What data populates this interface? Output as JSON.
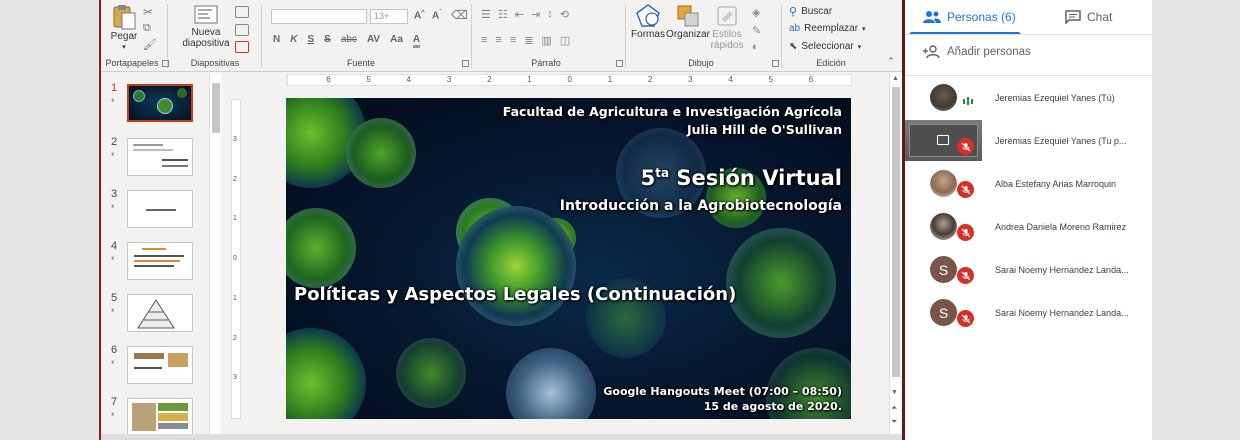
{
  "ribbon": {
    "groups": [
      {
        "label": "Portapapeles"
      },
      {
        "label": "Diapositivas"
      },
      {
        "label": "Fuente"
      },
      {
        "label": "Párrafo"
      },
      {
        "label": "Dibujo"
      },
      {
        "label": "Edición"
      }
    ],
    "paste_label": "Pegar",
    "new_slide_label_1": "Nueva",
    "new_slide_label_2": "diapositiva",
    "font_size": "13+",
    "formatting": [
      "N",
      "K",
      "S",
      "S",
      "abc",
      "AV",
      "Aa",
      "A"
    ],
    "drawing": {
      "shapes_label": "Formas",
      "arrange_label": "Organizar",
      "quick_styles_label_1": "Estilos",
      "quick_styles_label_2": "rápidos"
    },
    "editing": {
      "find_label": "Buscar",
      "replace_label": "Reemplazar",
      "select_label": "Seleccionar"
    }
  },
  "thumbnails": [
    {
      "num": "1",
      "star": "*"
    },
    {
      "num": "2",
      "star": "*"
    },
    {
      "num": "3",
      "star": "*"
    },
    {
      "num": "4",
      "star": "*"
    },
    {
      "num": "5",
      "star": "*"
    },
    {
      "num": "6",
      "star": "*"
    },
    {
      "num": "7",
      "star": "*"
    }
  ],
  "ruler_h": [
    "6",
    "5",
    "4",
    "3",
    "2",
    "1",
    "0",
    "1",
    "2",
    "3",
    "4",
    "5",
    "6"
  ],
  "ruler_v": [
    "3",
    "2",
    "1",
    "0",
    "1",
    "2",
    "3"
  ],
  "slide": {
    "faculty": "Facultad de Agricultura e Investigación Agrícola",
    "author": "Julia Hill de O'Sullivan",
    "session_num": "5",
    "session_sup": "ta",
    "session_rest": " Sesión Virtual",
    "subtitle": "Introducción a la Agrobiotecnología",
    "main_title": "Políticas y Aspectos Legales (Continuación)",
    "meet_info": "Google Hangouts Meet (07:00 – 08:50)",
    "date": "15 de agosto de 2020."
  },
  "meet": {
    "people_tab": "Personas (6)",
    "chat_tab": "Chat",
    "add_people": "Añadir personas",
    "accent_color": "#1a73e8",
    "participants": [
      {
        "name": "Jeremias Ezequiel Yanes (Tú)",
        "avatar": "photo",
        "status": "speaking"
      },
      {
        "name": "Jeremias Ezequiel Yanes (Tu p...",
        "avatar": "presentation",
        "status": "muted"
      },
      {
        "name": "Alba Estefany Arias Marroquin",
        "avatar": "photo",
        "status": "muted"
      },
      {
        "name": "Andrea Daniela Moreno Ramirez",
        "avatar": "photo",
        "status": "muted"
      },
      {
        "name": "Sarai Noemy Hernandez Landa...",
        "avatar": "S",
        "status": "muted"
      },
      {
        "name": "Sarai Noemy Hernandez Landa...",
        "avatar": "S",
        "status": "muted"
      }
    ]
  }
}
